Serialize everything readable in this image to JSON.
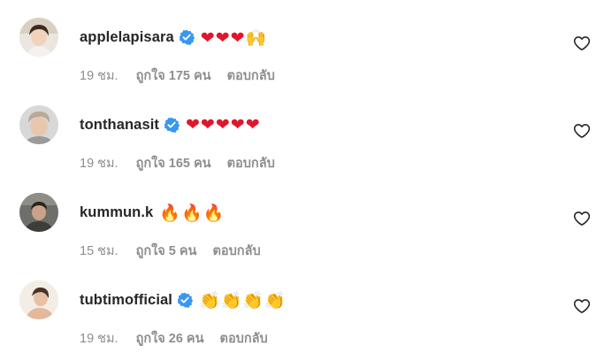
{
  "comments": [
    {
      "username": "applelapisara",
      "verified": true,
      "text": "❤❤❤🙌",
      "emoji_kind": "hearts",
      "time": "19 ชม.",
      "likes": "ถูกใจ 175 คน",
      "reply": "ตอบกลับ"
    },
    {
      "username": "tonthanasit",
      "verified": true,
      "text": "❤❤❤❤❤",
      "emoji_kind": "hearts",
      "time": "19 ชม.",
      "likes": "ถูกใจ 165 คน",
      "reply": "ตอบกลับ"
    },
    {
      "username": "kummun.k",
      "verified": false,
      "text": "🔥🔥🔥",
      "emoji_kind": "fire",
      "time": "15 ชม.",
      "likes": "ถูกใจ 5 คน",
      "reply": "ตอบกลับ"
    },
    {
      "username": "tubtimofficial",
      "verified": true,
      "text": "👏👏👏👏",
      "emoji_kind": "clap",
      "time": "19 ชม.",
      "likes": "ถูกใจ 26 คน",
      "reply": "ตอบกลับ"
    }
  ],
  "icons": {
    "verified_badge": "verified-badge-icon",
    "like": "heart-outline-icon"
  },
  "colors": {
    "verified_blue": "#3897f0",
    "meta_gray": "#8e8e8e",
    "username": "#262626"
  }
}
